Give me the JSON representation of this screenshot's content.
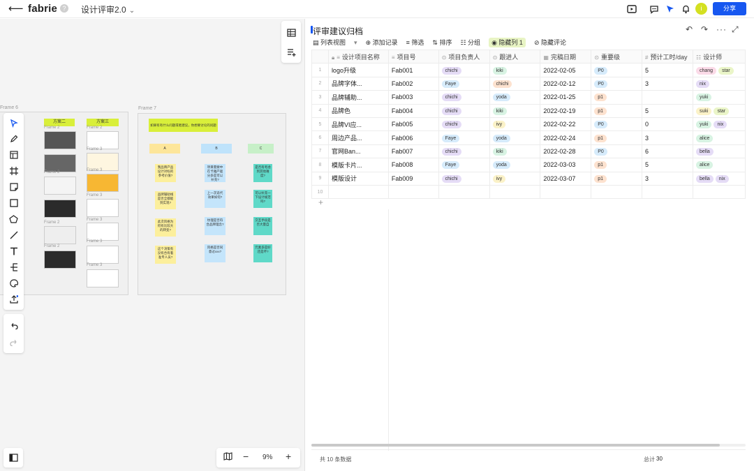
{
  "topbar": {
    "logo": "fabrie",
    "help": "?",
    "doc_title": "设计评审2.0",
    "avatar_letter": "i",
    "share_label": "分享"
  },
  "canvas": {
    "frames": {
      "frame6": "Frame 6",
      "frame7": "Frame 7"
    },
    "column_headers": [
      "方案二",
      "方案三"
    ],
    "thumb_label": "Frame 2",
    "thumb_label_alt": "Frame 3",
    "frame7_header": "如果有有什么问题或者建议，你想要讨论的问题",
    "abc": [
      "A",
      "B",
      "C"
    ],
    "notes_a": [
      "我品牌产品设计对标的参考价值?",
      "品牌辅助线是否全都能到实现?",
      "此次风格为何有比较大的转变?",
      "这个决策有没有合有着准专人员?"
    ],
    "notes_b": [
      "项目需要中在卡雅产驱分多是可以补充?",
      "上一次迭代效果如何?",
      "纹理是否符合品牌理念?",
      "风格是否同意过xxx?"
    ],
    "notes_c": [
      "是否有考虑到其他难度?",
      "可以补充一下设计规范吗?",
      "交互手段是否大量自",
      "元素多是好还是坏?"
    ],
    "zoom": "9%"
  },
  "panel": {
    "title": "评审建议归档",
    "toolbar": {
      "view": "列表视图",
      "add": "添加记录",
      "filter": "筛选",
      "sort": "排序",
      "group": "分组",
      "hidden_cols": "隐藏列 1",
      "hide_comments": "隐藏评论"
    },
    "columns": [
      "设计项目名称",
      "项目号",
      "项目负责人",
      "跟进人",
      "完稿日期",
      "重要级",
      "预计工时/day",
      "设计师"
    ],
    "rows": [
      {
        "idx": "1",
        "name": "logo升级",
        "no": "Fab001",
        "owner": "chichi",
        "follow": "kiki",
        "date": "2022-02-05",
        "level": "P0",
        "hours": "5",
        "designers": [
          "chang",
          "star"
        ]
      },
      {
        "idx": "2",
        "name": "品牌字体...",
        "no": "Fab002",
        "owner": "Faye",
        "follow": "chichi",
        "date": "2022-02-12",
        "level": "P0",
        "hours": "3",
        "designers": [
          "nix"
        ]
      },
      {
        "idx": "3",
        "name": "品牌辅助...",
        "no": "Fab003",
        "owner": "chichi",
        "follow": "yoda",
        "date": "2022-01-25",
        "level": "p1",
        "hours": "",
        "designers": [
          "yuki"
        ]
      },
      {
        "idx": "4",
        "name": "品牌色",
        "no": "Fab004",
        "owner": "chichi",
        "follow": "kiki",
        "date": "2022-02-19",
        "level": "p1",
        "hours": "5",
        "designers": [
          "suki",
          "star"
        ]
      },
      {
        "idx": "5",
        "name": "品牌VI应...",
        "no": "Fab005",
        "owner": "chichi",
        "follow": "ivy",
        "date": "2022-02-22",
        "level": "P0",
        "hours": "0",
        "designers": [
          "yuki",
          "nix"
        ]
      },
      {
        "idx": "6",
        "name": "周边产品...",
        "no": "Fab006",
        "owner": "Faye",
        "follow": "yoda",
        "date": "2022-02-24",
        "level": "p1",
        "hours": "3",
        "designers": [
          "alice"
        ]
      },
      {
        "idx": "7",
        "name": "官网Ban...",
        "no": "Fab007",
        "owner": "chichi",
        "follow": "kiki",
        "date": "2022-02-28",
        "level": "P0",
        "hours": "6",
        "designers": [
          "bella"
        ]
      },
      {
        "idx": "8",
        "name": "模版卡片...",
        "no": "Fab008",
        "owner": "Faye",
        "follow": "yoda",
        "date": "2022-03-03",
        "level": "p1",
        "hours": "5",
        "designers": [
          "alice"
        ]
      },
      {
        "idx": "9",
        "name": "模版设计",
        "no": "Fab009",
        "owner": "chichi",
        "follow": "ivy",
        "date": "2022-03-07",
        "level": "p1",
        "hours": "3",
        "designers": [
          "bella",
          "nix"
        ]
      }
    ],
    "empty_row_idx": "10",
    "footer": {
      "count": "共 10 条数据",
      "total_label": "总计",
      "total_value": "30"
    }
  },
  "colors": {
    "accent": "#1757f0",
    "frame_header": "#d9ef3a"
  }
}
